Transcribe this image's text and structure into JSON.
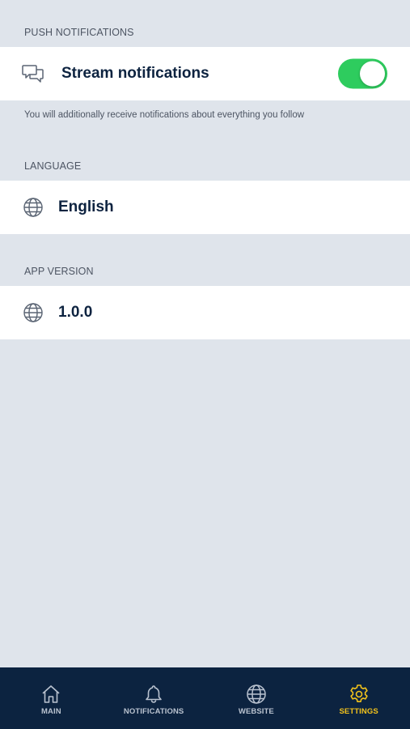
{
  "sections": {
    "push": {
      "header": "PUSH NOTIFICATIONS",
      "row_label": "Stream notifications",
      "row_icon": "chat-bubbles-icon",
      "toggle_on": true,
      "footnote": "You will additionally receive notifications about everything you follow"
    },
    "language": {
      "header": "LANGUAGE",
      "row_label": "English",
      "row_icon": "globe-icon"
    },
    "app_version": {
      "header": "APP VERSION",
      "row_label": "1.0.0",
      "row_icon": "globe-icon"
    }
  },
  "tabbar": {
    "tabs": [
      {
        "label": "MAIN",
        "icon": "home-icon",
        "active": false
      },
      {
        "label": "NOTIFICATIONS",
        "icon": "bell-icon",
        "active": false
      },
      {
        "label": "WEBSITE",
        "icon": "globe-icon",
        "active": false
      },
      {
        "label": "SETTINGS",
        "icon": "gear-icon",
        "active": true
      }
    ]
  },
  "colors": {
    "background": "#dfe4eb",
    "row_background": "#ffffff",
    "tabbar_background": "#0c2340",
    "toggle_on": "#2ecc5e",
    "active_tab": "#f2c21b",
    "inactive_tab": "#b9c2cf",
    "label_text": "#0d2340"
  }
}
